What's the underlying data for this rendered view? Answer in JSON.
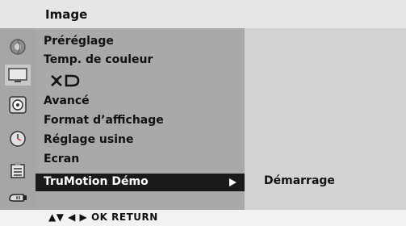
{
  "header": {
    "title": "Image"
  },
  "icons": [
    "picture-icon",
    "tv-screen-icon",
    "audio-icon",
    "timer-icon",
    "settings-icon",
    "input-icon"
  ],
  "menu": {
    "items": [
      {
        "label": "Préréglage"
      },
      {
        "label": "Temp. de couleur"
      },
      {
        "label": "XD"
      },
      {
        "label": "Avancé"
      },
      {
        "label": "Format d’affichage"
      },
      {
        "label": "Réglage usine"
      },
      {
        "label": "Ecran"
      }
    ],
    "selected": {
      "label": "TruMotion Démo"
    }
  },
  "submenu": {
    "item": "Démarrage"
  },
  "footer": {
    "hint": "▲▼ ◀ ▶ OK RETURN"
  },
  "colors": {
    "selection": "#1a1a1a",
    "menu_bg": "#a9a9a9",
    "header_bg": "#e6e6e6",
    "submenu_bg": "#d3d3d3"
  }
}
